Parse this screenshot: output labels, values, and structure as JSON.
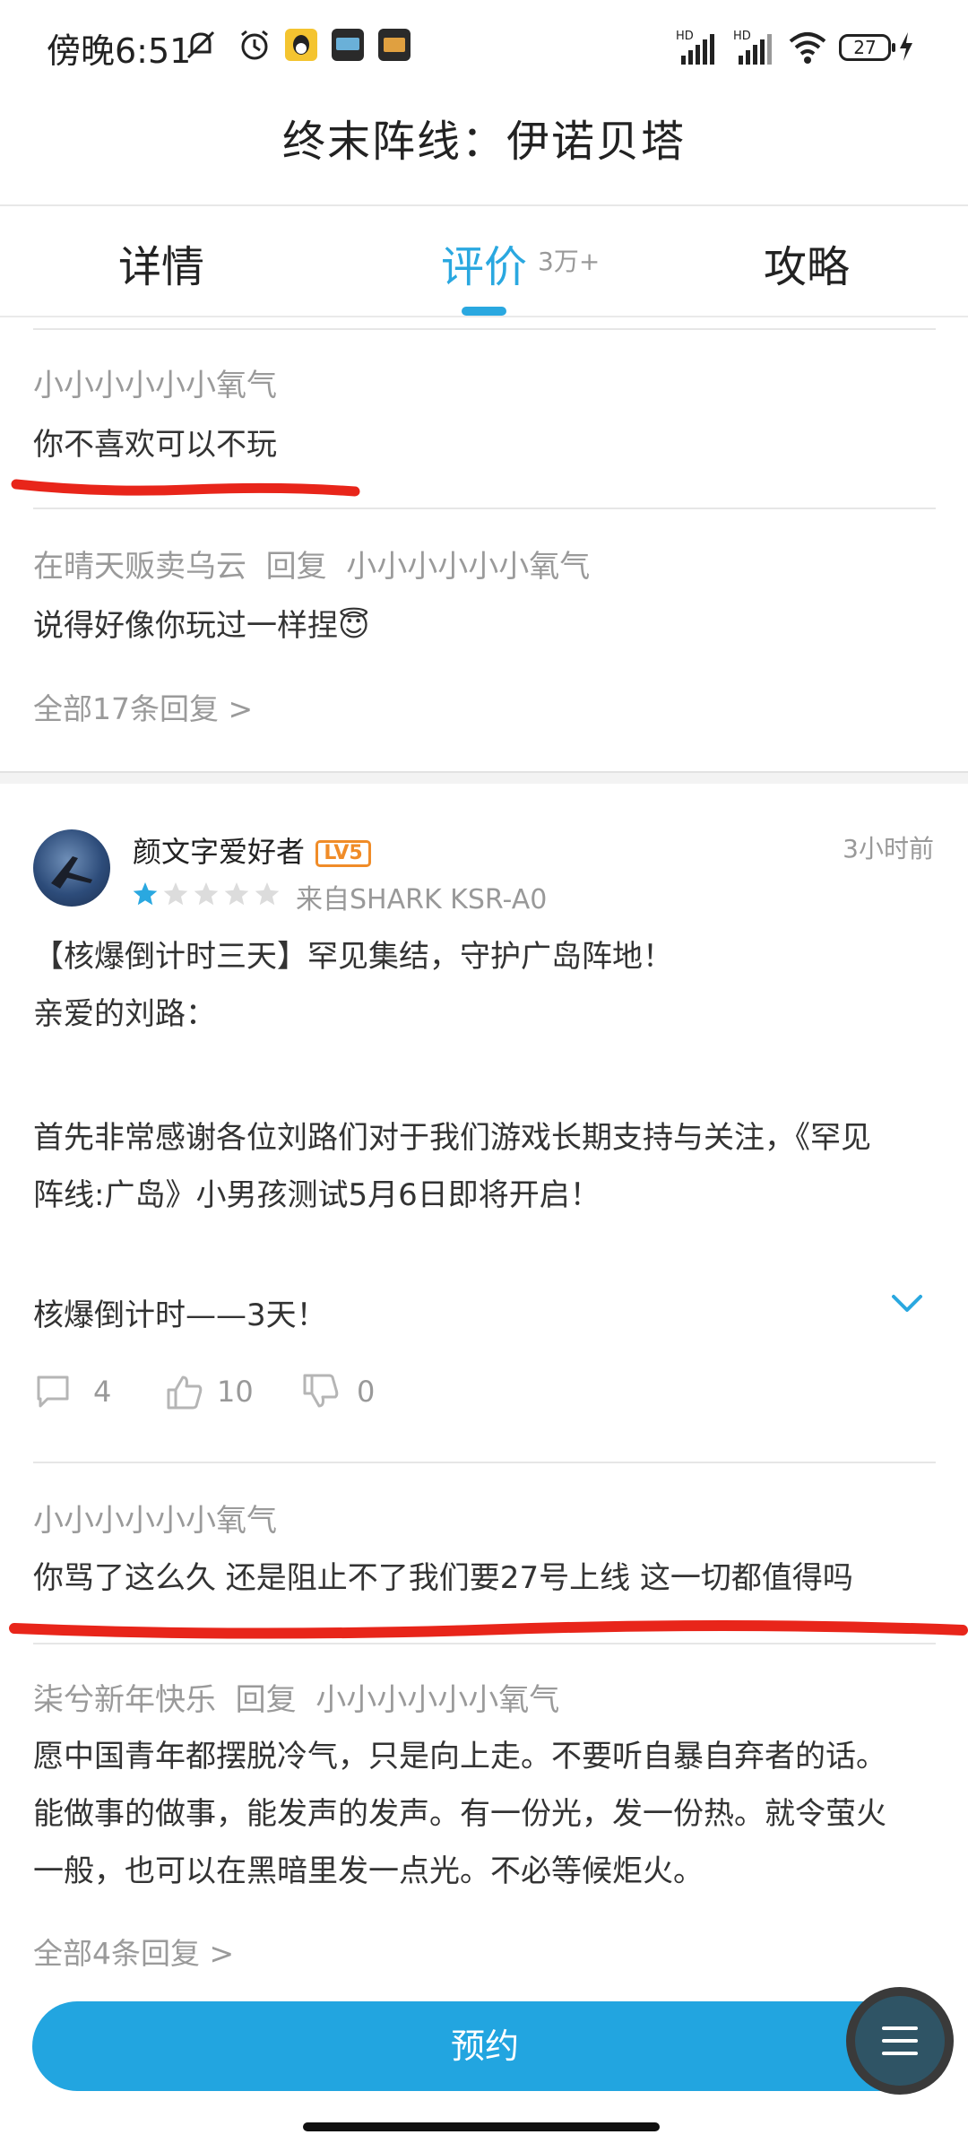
{
  "status_bar": {
    "time": "傍晚6:51",
    "battery": "27",
    "icons": [
      "mute-bell-icon",
      "alarm-icon",
      "qq-icon",
      "app-icon",
      "app-icon",
      "hd-signal-icon",
      "hd-signal-icon",
      "wifi-icon",
      "charging-icon"
    ]
  },
  "page": {
    "title": "终末阵线：伊诺贝塔"
  },
  "tabs": [
    {
      "label": "详情"
    },
    {
      "label": "评价",
      "count": "3万+"
    },
    {
      "label": "攻略"
    }
  ],
  "thread1": {
    "reply": {
      "user": "小小小小小小氧气",
      "text": "你不喜欢可以不玩"
    },
    "reply2": {
      "user": "在晴天贩卖乌云",
      "reply_word": "回复",
      "to": "小小小小小小氧气",
      "text": "说得好像你玩过一样捏😇"
    },
    "more": "全部17条回复 >"
  },
  "review": {
    "author": "颜文字爱好者",
    "level": "LV5",
    "time": "3小时前",
    "device": "来自SHARK KSR-A0",
    "rating": 1,
    "lines": {
      "l1": "【核爆倒计时三天】罕见集结，守护广岛阵地！",
      "l2": "亲爱的刘路：",
      "l3": "首先非常感谢各位刘路们对于我们游戏长期支持与关注，《罕见",
      "l4": "阵线:广岛》小男孩测试5月6日即将开启！",
      "l5": "核爆倒计时——3天！"
    },
    "stats": {
      "comments": "4",
      "likes": "10",
      "dislikes": "0"
    }
  },
  "thread2": {
    "reply": {
      "user": "小小小小小小氧气",
      "text": "你骂了这么久 还是阻止不了我们要27号上线 这一切都值得吗"
    },
    "reply2": {
      "user": "柒兮新年快乐",
      "reply_word": "回复",
      "to": "小小小小小小氧气",
      "l1": "愿中国青年都摆脱冷气，只是向上走。不要听自暴自弃者的话。",
      "l2": "能做事的做事，能发声的发声。有一份光，发一份热。就令萤火",
      "l3": "一般，也可以在黑暗里发一点光。不必等候炬火。"
    },
    "more": "全部4条回复 >"
  },
  "bottom": {
    "reserve_label": "预约"
  },
  "colors": {
    "accent": "#2aa8e0",
    "button": "#22a5e0",
    "annotation": "#e8251a",
    "level": "#f08c28"
  }
}
